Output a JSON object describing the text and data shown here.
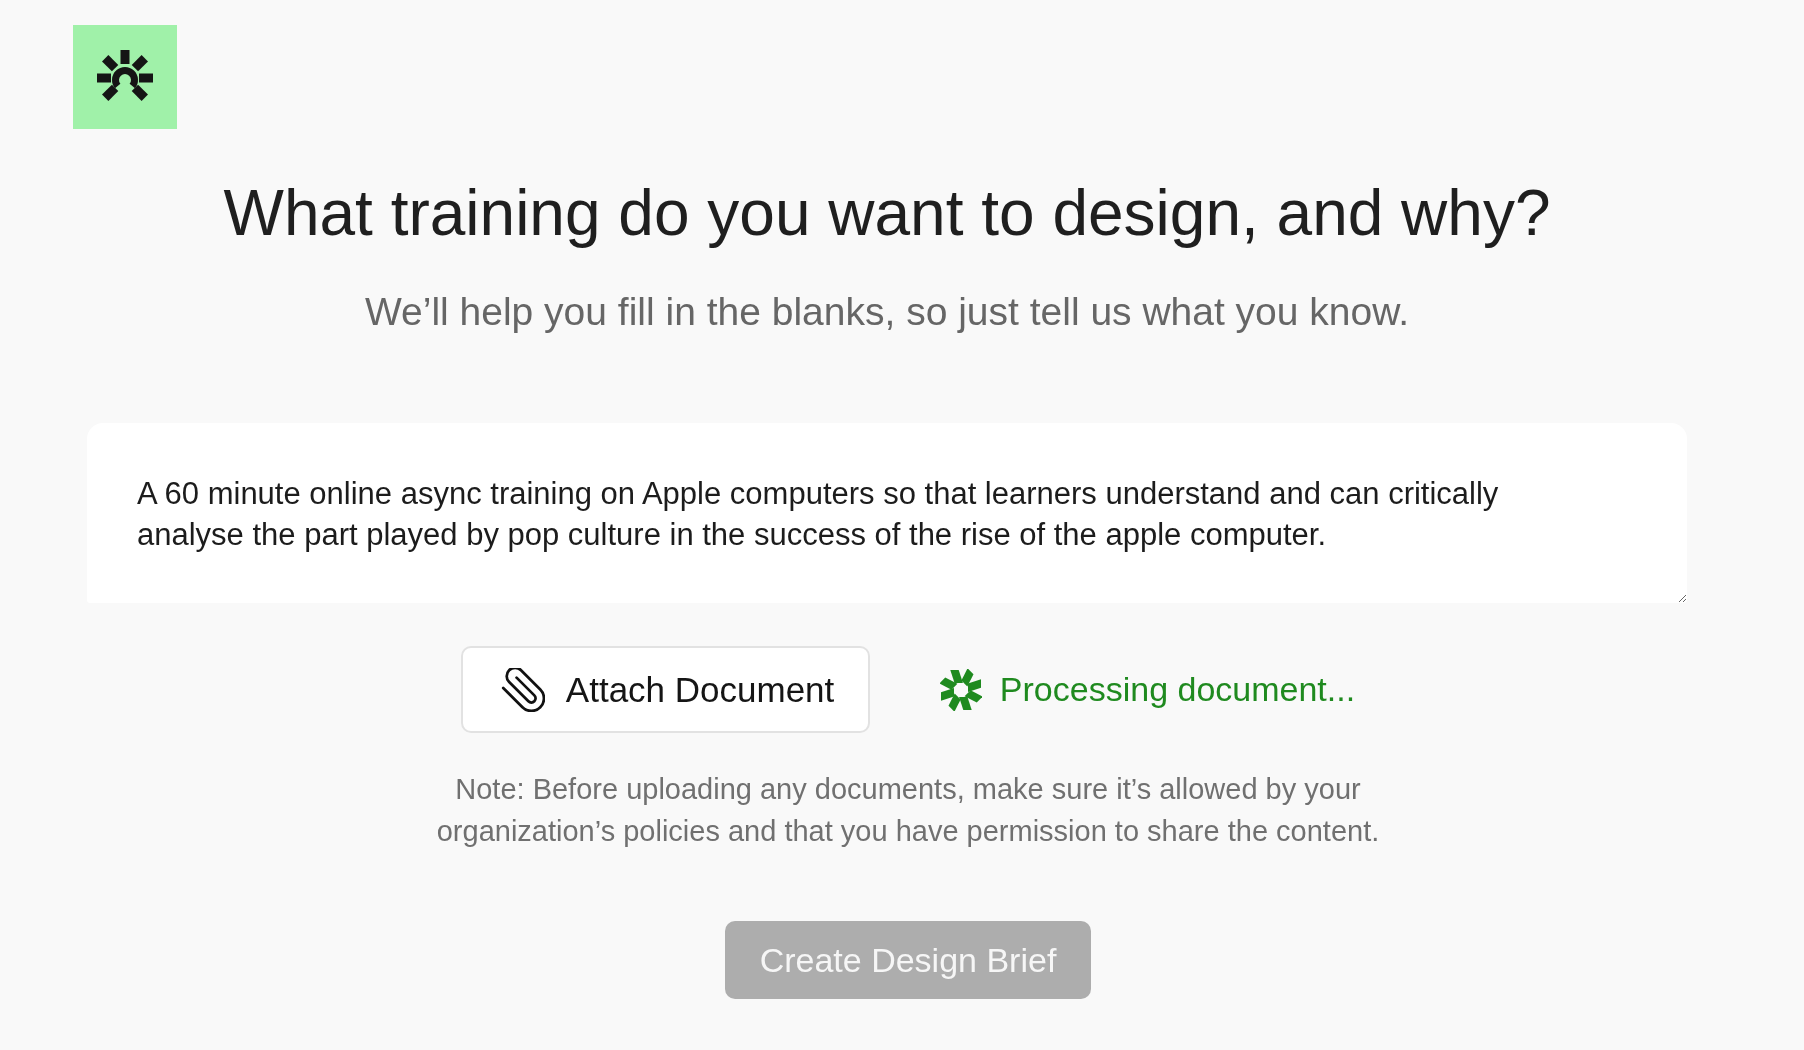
{
  "heading": "What training do you want to design, and why?",
  "subtitle": "We’ll help you fill in the blanks, so just tell us what you know.",
  "prompt": {
    "value": "A 60 minute online async training on Apple computers so that learners understand and can critically analyse the part played by pop culture in the success of the rise of the apple computer."
  },
  "attach_button": {
    "label": "Attach Document"
  },
  "status": {
    "text": "Processing document..."
  },
  "note": "Note: Before uploading any documents, make sure it’s allowed by your organization’s policies and that you have permission to share the content.",
  "submit_button": {
    "label": "Create Design Brief",
    "disabled": true
  }
}
